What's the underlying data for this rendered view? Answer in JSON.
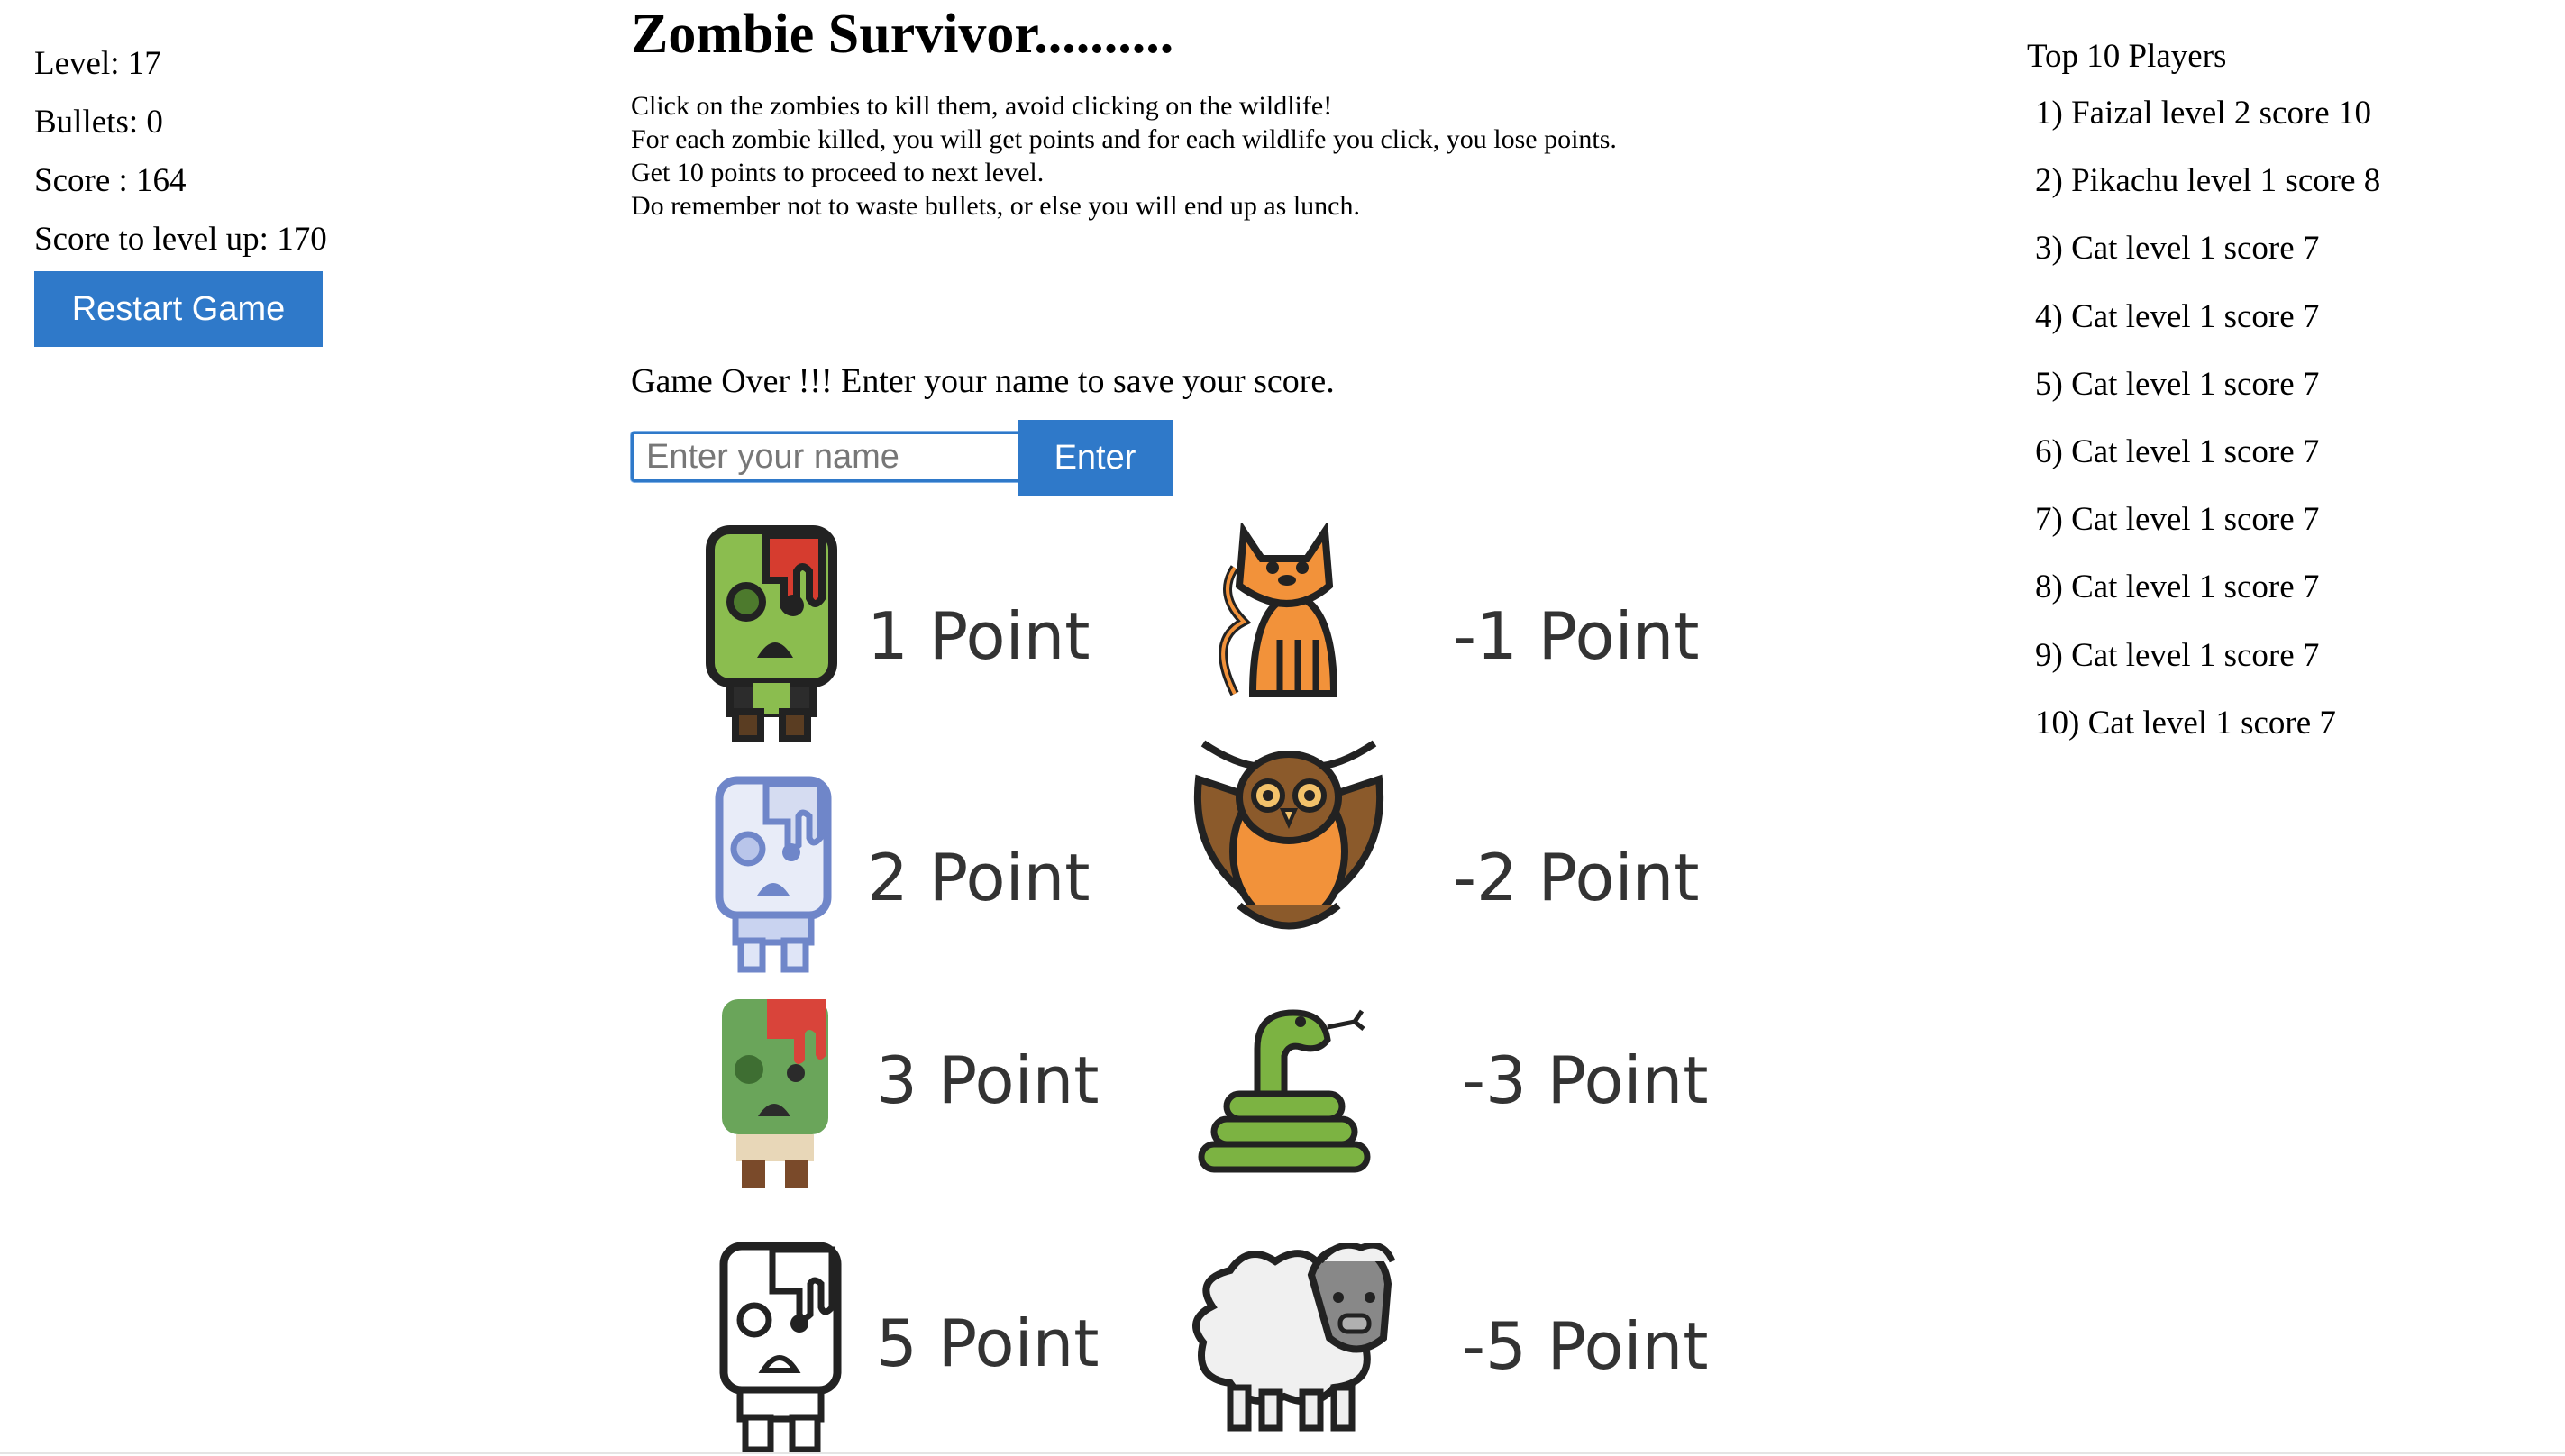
{
  "stats": {
    "level": "Level: 17",
    "bullets": "Bullets: 0",
    "score": "Score : 164",
    "score_to_level_up": "Score to level up: 170"
  },
  "restart_label": "Restart Game",
  "title": "Zombie Survivor..........",
  "instructions": [
    "Click on the zombies to kill them, avoid clicking on the wildlife!",
    "For each zombie killed, you will get points and for each wildlife you click, you lose points.",
    "Get 10 points to proceed to next level.",
    "Do remember not to waste bullets, or else you will end up as lunch."
  ],
  "game_over_message": "Game Over !!! Enter your name to save your score.",
  "name_input": {
    "placeholder": "Enter your name",
    "value": ""
  },
  "enter_label": "Enter",
  "legend": {
    "zombies": [
      {
        "name": "green-zombie",
        "label": "1 Point",
        "color": "#7cb342"
      },
      {
        "name": "ghost-zombie",
        "label": "2 Point",
        "color": "#6f86c9"
      },
      {
        "name": "mossy-zombie",
        "label": "3 Point",
        "color": "#6aa55a"
      },
      {
        "name": "outline-zombie",
        "label": "5 Point",
        "color": "#333333"
      }
    ],
    "wildlife": [
      {
        "name": "cat",
        "label": "-1 Point",
        "color": "#f2923a"
      },
      {
        "name": "owl",
        "label": "-2 Point",
        "color": "#8b5a2b"
      },
      {
        "name": "snake",
        "label": "-3 Point",
        "color": "#7cb342"
      },
      {
        "name": "sheep",
        "label": "-5 Point",
        "color": "#f0f0f0"
      }
    ]
  },
  "leaderboard": {
    "title": "Top 10 Players",
    "entries": [
      "1) Faizal level 2 score 10",
      "2) Pikachu level 1 score 8",
      "3) Cat level 1 score 7",
      "4) Cat level 1 score 7",
      "5) Cat level 1 score 7",
      "6) Cat level 1 score 7",
      "7) Cat level 1 score 7",
      "8) Cat level 1 score 7",
      "9) Cat level 1 score 7",
      "10) Cat level 1 score 7"
    ]
  },
  "colors": {
    "accent": "#2f79c9"
  }
}
